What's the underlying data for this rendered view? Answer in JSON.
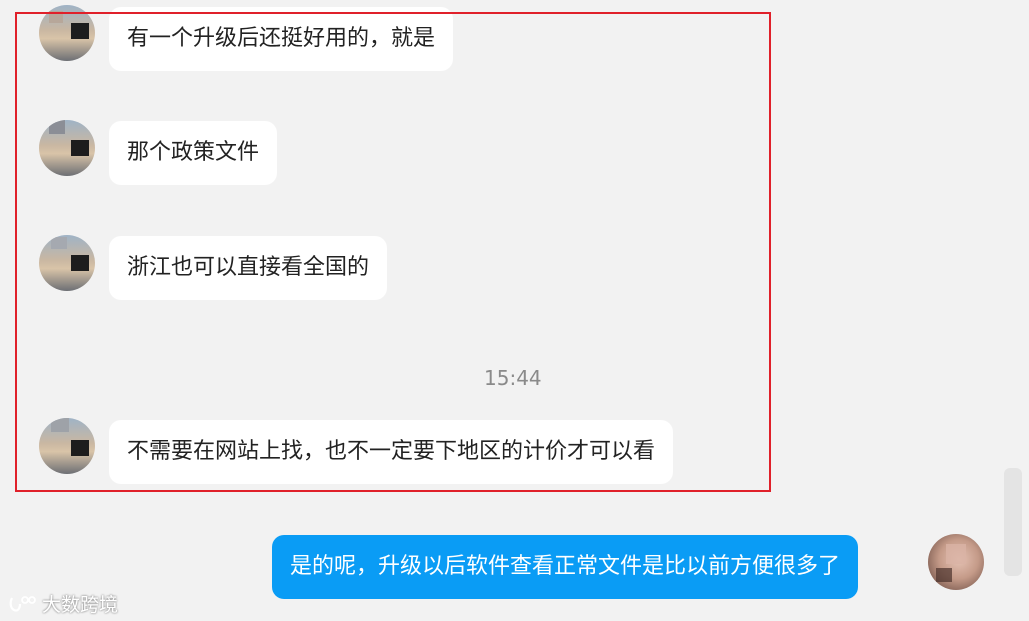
{
  "messages": [
    {
      "text": "有一个升级后还挺好用的，就是",
      "side": "left"
    },
    {
      "text": "那个政策文件",
      "side": "left"
    },
    {
      "text": "浙江也可以直接看全国的",
      "side": "left"
    },
    {
      "text": "不需要在网站上找，也不一定要下地区的计价才可以看",
      "side": "left"
    },
    {
      "text": "是的呢，升级以后软件查看正常文件是比以前方便很多了",
      "side": "right"
    }
  ],
  "timestamp": "15:44",
  "watermark": "大数跨境",
  "colors": {
    "background": "#f2f2f2",
    "incoming_bubble": "#ffffff",
    "outgoing_bubble": "#0a9cf5",
    "highlight_border": "#e0202a"
  }
}
